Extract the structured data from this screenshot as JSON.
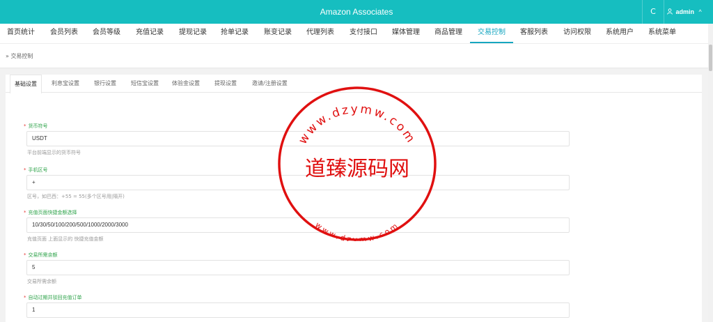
{
  "app": {
    "title": "Amazon Associates",
    "refresh_icon": "C",
    "user": "admin",
    "user_caret": "^"
  },
  "nav": {
    "items": [
      "首页统计",
      "会员列表",
      "会员等级",
      "充值记录",
      "提现记录",
      "抢单记录",
      "账变记录",
      "代理列表",
      "支付接口",
      "媒体管理",
      "商品管理",
      "交易控制",
      "客服列表",
      "访问权限",
      "系统用户",
      "系统菜单"
    ],
    "active": "交易控制"
  },
  "breadcrumb": "» 交易控制",
  "tabs": {
    "items": [
      "基础设置",
      "利息宝设置",
      "银行设置",
      "短信宝设置",
      "体验金设置",
      "提现设置",
      "邀请/注册设置"
    ],
    "active": "基础设置"
  },
  "form": [
    {
      "label": "货币符号",
      "value": "USDT",
      "hint": "平台前端显示的货币符号"
    },
    {
      "label": "手机区号",
      "value": "+",
      "hint": "区号，如巴西：+55 = 55(多个区号用|隔开)"
    },
    {
      "label": "充值页面快捷金额选择",
      "value": "10/30/50/100/200/500/1000/2000/3000",
      "hint": "充值页面 上面显示的 快捷充值金额"
    },
    {
      "label": "交易所需余额",
      "value": "5",
      "hint": "交易所需余额"
    },
    {
      "label": "自动过期并驳回充值订单",
      "value": "1",
      "hint": ""
    }
  ],
  "watermark": {
    "top_arc": "www.dzymw.com",
    "center": "道臻源码网",
    "bottom_arc": "www.dzymw.com",
    "color": "#e01010"
  }
}
